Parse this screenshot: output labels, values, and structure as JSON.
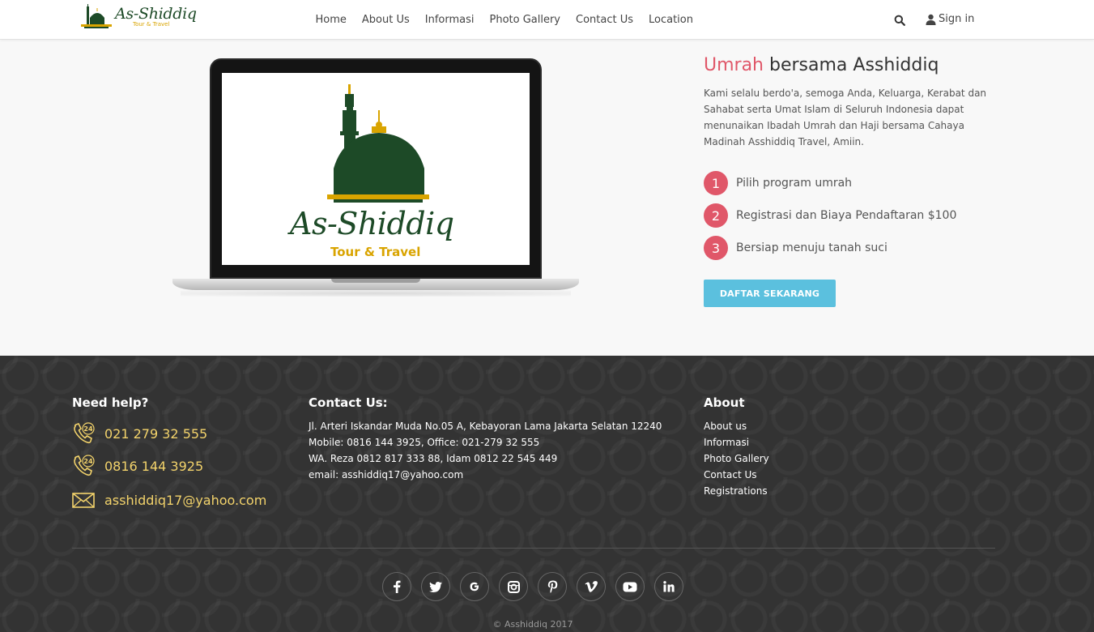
{
  "header": {
    "logo_text": "As-Shiddiq",
    "logo_subtext": "Tour & Travel",
    "nav": [
      "Home",
      "About Us",
      "Informasi",
      "Photo Gallery",
      "Contact Us",
      "Location"
    ],
    "signin_label": "Sign in"
  },
  "hero": {
    "screen_logo_text": "As-Shiddiq",
    "screen_logo_subtext": "Tour & Travel",
    "title_accent": "Umrah",
    "title_rest": " bersama Asshiddiq",
    "description": "Kami selalu berdo'a, semoga Anda, Keluarga, Kerabat dan Sahabat serta Umat Islam di Seluruh Indonesia dapat menunaikan Ibadah Umrah dan Haji bersama Cahaya Madinah Asshiddiq Travel, Amiin.",
    "steps": [
      {
        "num": "1",
        "label": "Pilih program umrah"
      },
      {
        "num": "2",
        "label": "Registrasi dan Biaya Pendaftaran $100"
      },
      {
        "num": "3",
        "label": "Bersiap menuju tanah suci"
      }
    ],
    "cta_label": "DAFTAR SEKARANG"
  },
  "footer": {
    "help_title": "Need help?",
    "phone1": "021 279 32 555",
    "phone2": "0816 144 3925",
    "email": "asshiddiq17@yahoo.com",
    "contact_title": "Contact Us:",
    "contact_lines": [
      "Jl. Arteri Iskandar Muda No.05 A, Kebayoran Lama Jakarta Selatan 12240",
      "Mobile: 0816 144 3925, Office: 021-279 32 555",
      "WA. Reza 0812 817 333 88, Idam 0812 22 545 449",
      "email: asshiddiq17@yahoo.com"
    ],
    "about_title": "About",
    "about_links": [
      "About us",
      "Informasi",
      "Photo Gallery",
      "Contact Us",
      "Registrations"
    ],
    "copyright": "© Asshiddiq 2017"
  },
  "colors": {
    "accent": "#e05769",
    "cta": "#5bc0de",
    "footer_bg": "#333333",
    "highlight": "#f3d36b",
    "brand_green": "#1d4a27"
  }
}
